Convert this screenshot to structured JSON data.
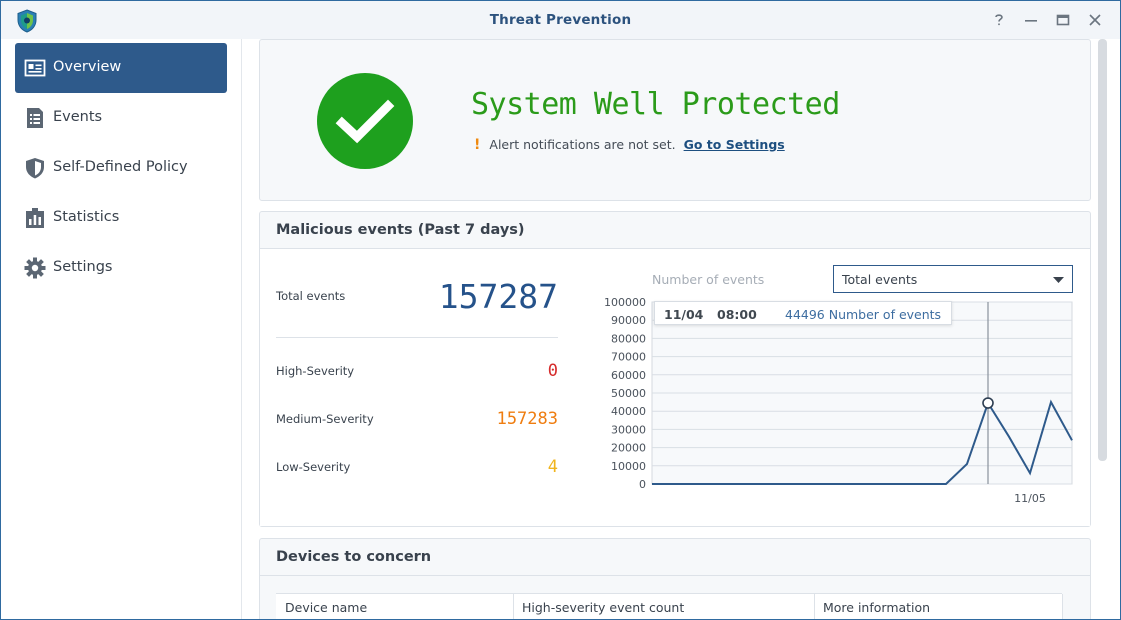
{
  "window": {
    "title": "Threat Prevention"
  },
  "sidebar": {
    "items": [
      {
        "label": "Overview",
        "icon": "overview-card-icon",
        "active": true
      },
      {
        "label": "Events",
        "icon": "list-document-icon",
        "active": false
      },
      {
        "label": "Self-Defined Policy",
        "icon": "shield-icon",
        "active": false
      },
      {
        "label": "Statistics",
        "icon": "statistics-chart-icon",
        "active": false
      },
      {
        "label": "Settings",
        "icon": "gear-icon",
        "active": false
      }
    ]
  },
  "status": {
    "title": "System Well Protected",
    "alert_text": "Alert notifications are not set.",
    "alert_link": "Go to Settings"
  },
  "events": {
    "title": "Malicious events (Past 7 days)",
    "total_label": "Total events",
    "total_value": "157287",
    "severities": [
      {
        "label": "High-Severity",
        "value": "0",
        "color": "#d62b2b"
      },
      {
        "label": "Medium-Severity",
        "value": "157283",
        "color": "#ef7d10"
      },
      {
        "label": "Low-Severity",
        "value": "4",
        "color": "#f0b41e"
      }
    ],
    "chart_label": "Number of events",
    "dropdown_value": "Total events",
    "tooltip": {
      "date": "11/04",
      "time": "08:00",
      "value_text": "44496 Number of events"
    }
  },
  "chart_data": {
    "type": "line",
    "ylabel": "Number of events",
    "ylim": [
      0,
      100000
    ],
    "yticks": [
      0,
      10000,
      20000,
      30000,
      40000,
      50000,
      60000,
      70000,
      80000,
      90000,
      100000
    ],
    "xtick_labels": [
      "11/05"
    ],
    "series": [
      {
        "name": "Number of events",
        "values": [
          0,
          0,
          0,
          0,
          0,
          0,
          0,
          0,
          0,
          0,
          0,
          0,
          0,
          0,
          0,
          11000,
          44496,
          26000,
          6000,
          45000,
          24000
        ]
      }
    ],
    "highlight_index": 16,
    "grid": true,
    "color": "#2e5a8b"
  },
  "devices": {
    "title": "Devices to concern",
    "columns": [
      "Device name",
      "High-severity event count",
      "More information"
    ]
  }
}
